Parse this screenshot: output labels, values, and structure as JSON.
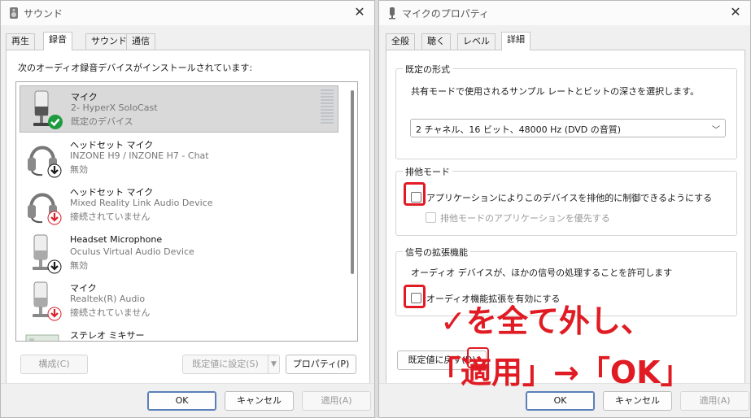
{
  "sound": {
    "title": "サウンド",
    "tabs": [
      "再生",
      "録音",
      "サウンド",
      "通信"
    ],
    "active_tab": 1,
    "instruction": "次のオーディオ録音デバイスがインストールされています:",
    "devices": [
      {
        "name": "マイク",
        "sub": "2- HyperX SoloCast",
        "status": "既定のデバイス",
        "icon": "mic-icon",
        "badge": "default-check-badge",
        "selected": true
      },
      {
        "name": "ヘッドセット マイク",
        "sub": "INZONE H9 / INZONE H7 - Chat",
        "status": "無効",
        "icon": "headset-icon",
        "badge": "disabled-arrow-badge",
        "selected": false
      },
      {
        "name": "ヘッドセット マイク",
        "sub": "Mixed Reality Link Audio Device",
        "status": "接続されていません",
        "icon": "headset-icon",
        "badge": "disconnected-arrow-badge",
        "selected": false
      },
      {
        "name": "Headset Microphone",
        "sub": "Oculus Virtual Audio Device",
        "status": "無効",
        "icon": "mic-icon",
        "badge": "disabled-arrow-badge",
        "selected": false
      },
      {
        "name": "マイク",
        "sub": "Realtek(R) Audio",
        "status": "接続されていません",
        "icon": "mic-icon",
        "badge": "disconnected-arrow-badge",
        "selected": false
      },
      {
        "name": "ステレオ ミキサー",
        "sub": "",
        "status": "",
        "icon": "stereo-mixer-icon",
        "badge": "",
        "selected": false
      }
    ],
    "configure_button": "構成(C)",
    "set_default_button": "既定値に設定(S)",
    "properties_button": "プロパティ(P)",
    "ok_button": "OK",
    "cancel_button": "キャンセル",
    "apply_button": "適用(A)"
  },
  "props": {
    "title": "マイクのプロパティ",
    "tabs": [
      "全般",
      "聴く",
      "レベル",
      "詳細"
    ],
    "active_tab": 3,
    "default_format_label": "既定の形式",
    "default_format_desc": "共有モードで使用されるサンプル レートとビットの深さを選択します。",
    "format_value": "2 チャネル、16 ビット、48000 Hz (DVD の音質)",
    "exclusive_label": "排他モード",
    "exclusive_check1": "アプリケーションによりこのデバイスを排他的に制御できるようにする",
    "exclusive_check2": "排他モードのアプリケーションを優先する",
    "enhance_label": "信号の拡張機能",
    "enhance_desc": "オーディオ デバイスが、ほかの信号の処理することを許可します",
    "enhance_check": "オーディオ機能拡張を有効にする",
    "restore_button": "既定値に戻す(D)",
    "ok_button": "OK",
    "cancel_button": "キャンセル",
    "apply_button": "適用(A)"
  },
  "annotation": {
    "line1": "✓を全て外し、",
    "line2": "「適用」→「OK」"
  },
  "colors": {
    "annotation": "#e01b24",
    "check_badge": "#1f9b3f",
    "arrow_badge": "#1a1a1a",
    "red_arrow_badge": "#d8232a"
  }
}
